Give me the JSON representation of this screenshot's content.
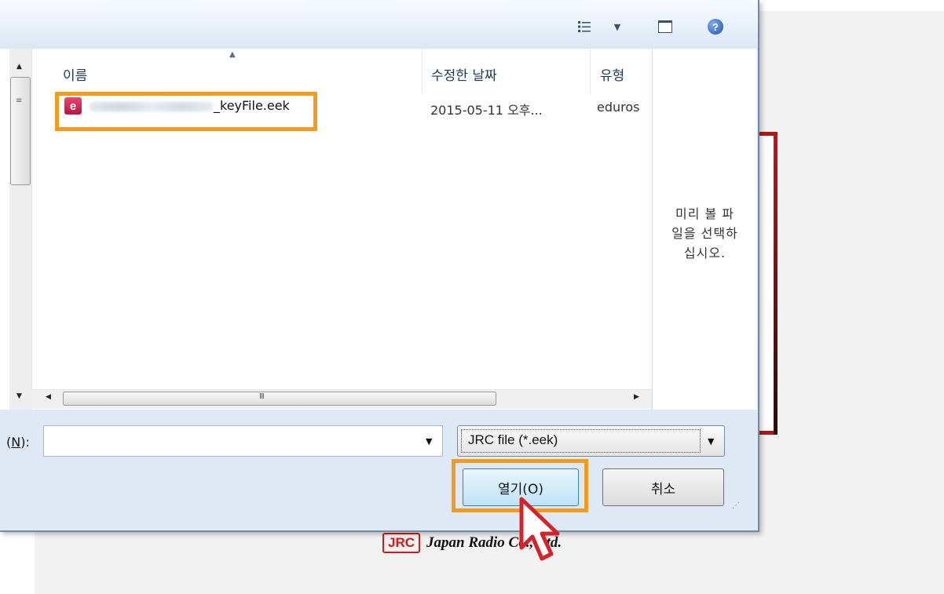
{
  "toolbar": {
    "views_icon": "view-options-icon",
    "pane_icon": "preview-pane-icon",
    "help_icon": "help-icon",
    "help_glyph": "?"
  },
  "file_list": {
    "columns": [
      "이름",
      "수정한 날짜",
      "유형"
    ],
    "files": [
      {
        "icon_letter": "e",
        "name_suffix": "_keyFile.eek",
        "modified": "2015-05-11 오후...",
        "type": "eduros"
      }
    ]
  },
  "preview": {
    "message_lines": [
      "미리 볼 파",
      "일을 선택하",
      "십시오."
    ]
  },
  "footer": {
    "name_label_prefix": "",
    "name_label_key": "N",
    "name_label_suffix": "):",
    "name_label_open": "(",
    "file_name_value": "",
    "filter_value": "JRC file (*.eek)",
    "open_label": "열기(O)",
    "cancel_label": "취소"
  },
  "background": {
    "logo_badge": "JRC",
    "logo_text": "Japan Radio Co., Ltd."
  },
  "colors": {
    "highlight": "#f29c1f",
    "cursor_outline": "#d4232b"
  }
}
